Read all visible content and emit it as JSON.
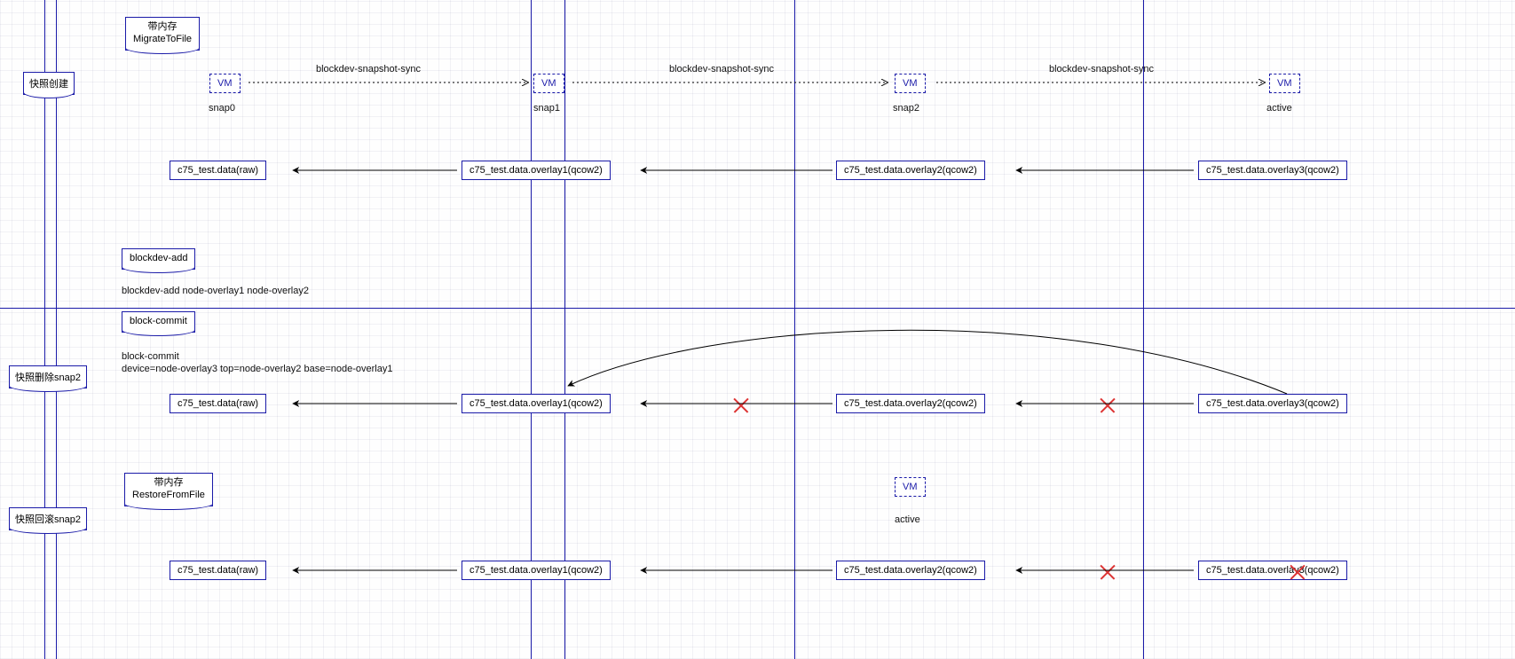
{
  "diagram": {
    "migrate_note_line1": "带内存",
    "migrate_note_line2": "MigrateToFile",
    "restore_note_line1": "带内存",
    "restore_note_line2": "RestoreFromFile",
    "blockdev_add_note": "blockdev-add",
    "blockdev_add_text": "blockdev-add node-overlay1 node-overlay2",
    "block_commit_note": "block-commit",
    "block_commit_text1": "block-commit",
    "block_commit_text2": "device=node-overlay3 top=node-overlay2 base=node-overlay1",
    "section_create": "快照创建",
    "section_delete": "快照删除snap2",
    "section_rollback": "快照回滚snap2",
    "snap_sync": "blockdev-snapshot-sync",
    "vm": "VM",
    "snap0_label": "snap0",
    "snap1_label": "snap1",
    "snap2_label": "snap2",
    "active_label": "active",
    "file_raw": "c75_test.data(raw)",
    "file_ov1": "c75_test.data.overlay1(qcow2)",
    "file_ov2": "c75_test.data.overlay2(qcow2)",
    "file_ov3": "c75_test.data.overlay3(qcow2)"
  },
  "chart_data": {
    "type": "diagram",
    "title": "QEMU blockdev snapshot lifecycle",
    "sections": [
      {
        "name": "快照创建",
        "note": "带内存 MigrateToFile",
        "vms": [
          {
            "label": "snap0",
            "file": "c75_test.data(raw)"
          },
          {
            "label": "snap1",
            "file": "c75_test.data.overlay1(qcow2)",
            "created_by": "blockdev-snapshot-sync"
          },
          {
            "label": "snap2",
            "file": "c75_test.data.overlay2(qcow2)",
            "created_by": "blockdev-snapshot-sync"
          },
          {
            "label": "active",
            "file": "c75_test.data.overlay3(qcow2)",
            "created_by": "blockdev-snapshot-sync"
          }
        ],
        "chain": [
          "c75_test.data.overlay3(qcow2)",
          "c75_test.data.overlay2(qcow2)",
          "c75_test.data.overlay1(qcow2)",
          "c75_test.data(raw)"
        ]
      },
      {
        "name": "快照删除snap2",
        "steps": [
          {
            "cmd": "blockdev-add",
            "text": "blockdev-add node-overlay1 node-overlay2"
          },
          {
            "cmd": "block-commit",
            "text": "block-commit device=node-overlay3 top=node-overlay2 base=node-overlay1"
          }
        ],
        "chain_before": [
          "c75_test.data.overlay3(qcow2)",
          "c75_test.data.overlay2(qcow2)",
          "c75_test.data.overlay1(qcow2)",
          "c75_test.data(raw)"
        ],
        "removed_links": [
          {
            "from": "c75_test.data.overlay3(qcow2)",
            "to": "c75_test.data.overlay2(qcow2)"
          },
          {
            "from": "c75_test.data.overlay2(qcow2)",
            "to": "c75_test.data.overlay1(qcow2)"
          }
        ],
        "added_link": {
          "from": "c75_test.data.overlay3(qcow2)",
          "to": "c75_test.data.overlay1(qcow2)"
        }
      },
      {
        "name": "快照回滚snap2",
        "note": "带内存 RestoreFromFile",
        "vm_active_at": "snap2",
        "chain": [
          "c75_test.data.overlay3(qcow2)",
          "c75_test.data.overlay2(qcow2)",
          "c75_test.data.overlay1(qcow2)",
          "c75_test.data(raw)"
        ],
        "removed_links": [
          {
            "from": "c75_test.data.overlay3(qcow2)",
            "to": "c75_test.data.overlay2(qcow2)"
          }
        ],
        "removed_nodes": [
          "c75_test.data.overlay3(qcow2)"
        ]
      }
    ]
  }
}
